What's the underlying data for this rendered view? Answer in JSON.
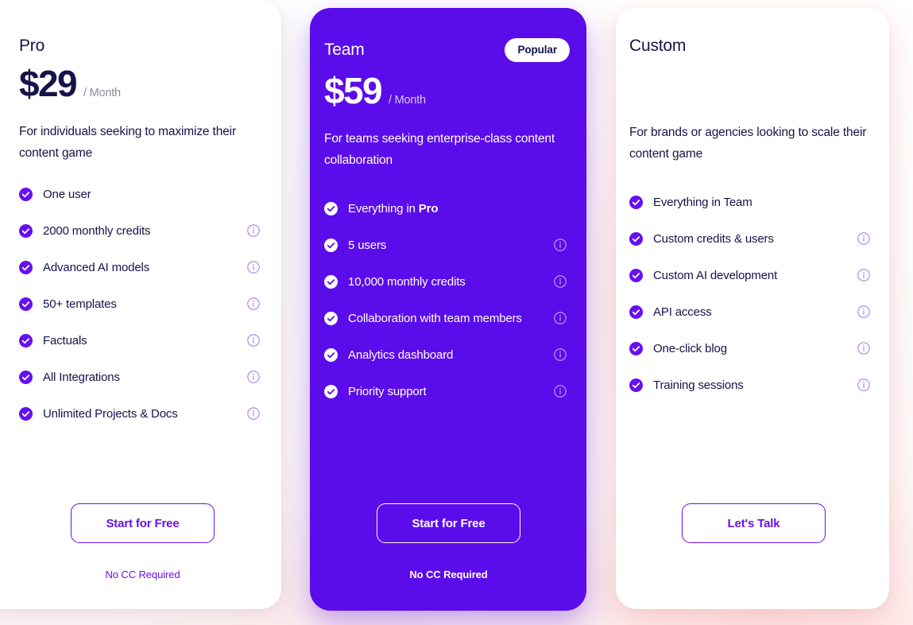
{
  "theme": {
    "accent": "#6610F2",
    "featured_bg": "#5B0CEB",
    "text_dark": "#16134A",
    "muted": "#8A8AA3"
  },
  "plans": [
    {
      "name": "Pro",
      "price": "$29",
      "period": "/ Month",
      "description": "For individuals seeking to maximize their content game",
      "badge": null,
      "features": [
        {
          "label": "One user",
          "info": false
        },
        {
          "label": "2000 monthly credits",
          "info": true
        },
        {
          "label": "Advanced AI models",
          "info": true
        },
        {
          "label": "50+ templates",
          "info": true
        },
        {
          "label": "Factuals",
          "info": true
        },
        {
          "label": "All Integrations",
          "info": true
        },
        {
          "label": "Unlimited Projects & Docs",
          "info": true
        }
      ],
      "cta_label": "Start for Free",
      "cta_note": "No CC Required"
    },
    {
      "name": "Team",
      "price": "$59",
      "period": "/ Month",
      "description": "For teams seeking enterprise-class content collaboration",
      "badge": "Popular",
      "features": [
        {
          "label": "Everything in ",
          "label_bold": "Pro",
          "info": false
        },
        {
          "label": "5 users",
          "info": true
        },
        {
          "label": "10,000 monthly credits",
          "info": true
        },
        {
          "label": "Collaboration with team members",
          "info": true
        },
        {
          "label": "Analytics dashboard",
          "info": true
        },
        {
          "label": "Priority support",
          "info": true
        }
      ],
      "cta_label": "Start for Free",
      "cta_note": "No CC Required"
    },
    {
      "name": "Custom",
      "price": "",
      "period": "",
      "description": "For brands or agencies looking to scale their content game",
      "badge": null,
      "features": [
        {
          "label": "Everything in Team",
          "info": false
        },
        {
          "label": "Custom credits & users",
          "info": true
        },
        {
          "label": "Custom AI development",
          "info": true
        },
        {
          "label": "API access",
          "info": true
        },
        {
          "label": "One-click blog",
          "info": true
        },
        {
          "label": "Training sessions",
          "info": true
        }
      ],
      "cta_label": "Let's Talk",
      "cta_note": null
    }
  ]
}
